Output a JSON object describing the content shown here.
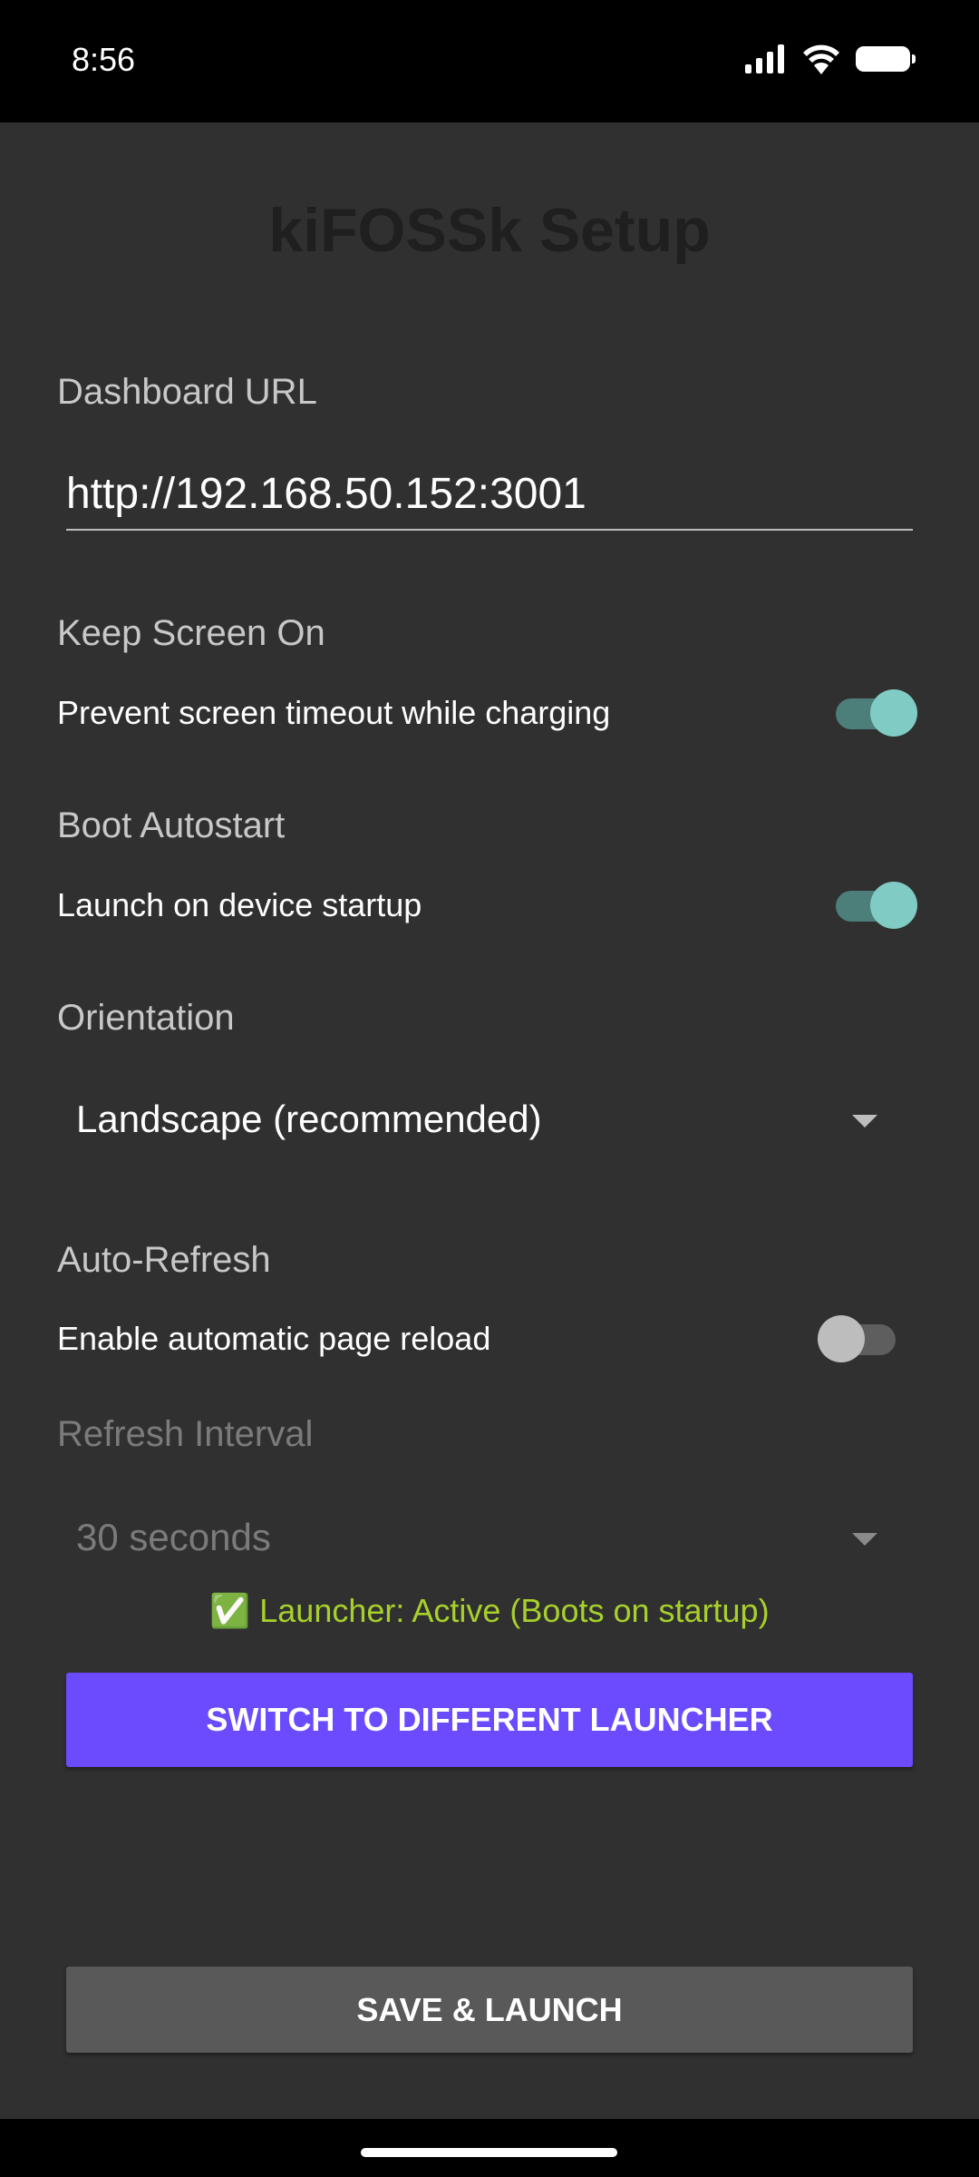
{
  "status_bar": {
    "time": "8:56",
    "icons": [
      "signal-icon",
      "wifi-icon",
      "battery-icon"
    ]
  },
  "app": {
    "title": "kiFOSSk Setup",
    "dashboard_url": {
      "label": "Dashboard URL",
      "value": "http://192.168.50.152:3001"
    },
    "keep_screen_on": {
      "label": "Keep Screen On",
      "description": "Prevent screen timeout while charging",
      "enabled": true
    },
    "boot_autostart": {
      "label": "Boot Autostart",
      "description": "Launch on device startup",
      "enabled": true
    },
    "orientation": {
      "label": "Orientation",
      "selected": "Landscape (recommended)"
    },
    "auto_refresh": {
      "label": "Auto-Refresh",
      "description": "Enable automatic page reload",
      "enabled": false
    },
    "refresh_interval": {
      "label": "Refresh Interval",
      "selected": "30 seconds",
      "disabled": true
    },
    "launcher_status": "✅ Launcher: Active (Boots on startup)",
    "switch_launcher_label": "SWITCH TO DIFFERENT LAUNCHER",
    "save_launch_label": "SAVE & LAUNCH"
  },
  "colors": {
    "background": "#303030",
    "accent": "#6c4bff",
    "switch_on": "#80cbc4",
    "status_ok": "#a8d02c"
  }
}
